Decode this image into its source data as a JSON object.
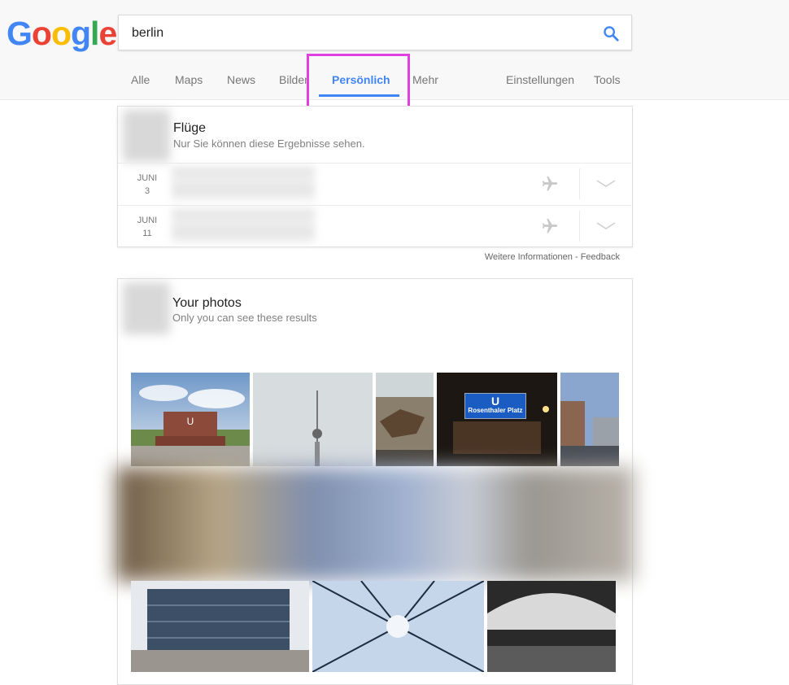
{
  "logo": {
    "letters": [
      "G",
      "o",
      "o",
      "g",
      "l",
      "e"
    ],
    "colors": [
      "#4285f4",
      "#ea4335",
      "#fbbc05",
      "#4285f4",
      "#34a853",
      "#ea4335"
    ]
  },
  "search": {
    "query": "berlin",
    "icon": "search-icon"
  },
  "nav": {
    "tabs": [
      {
        "label": "Alle"
      },
      {
        "label": "Maps"
      },
      {
        "label": "News"
      },
      {
        "label": "Bilder"
      },
      {
        "label": "Persönlich",
        "active": true
      },
      {
        "label": "Mehr"
      }
    ],
    "settings": "Einstellungen",
    "tools": "Tools"
  },
  "flights": {
    "title": "Flüge",
    "subtitle": "Nur Sie können diese Ergebnisse sehen.",
    "rows": [
      {
        "month": "JUNI",
        "day": "3",
        "icon": "plane-icon"
      },
      {
        "month": "JUNI",
        "day": "11",
        "icon": "plane-icon"
      }
    ]
  },
  "feedback": {
    "info": "Weitere Informationen",
    "separator": " - ",
    "feedback": "Feedback"
  },
  "photos": {
    "title": "Your photos",
    "subtitle": "Only you can see these results",
    "sign_line": "U",
    "sign_text": "Rosenthaler Platz"
  },
  "colors": {
    "accent": "#4285f4",
    "highlight": "#e040e0"
  }
}
